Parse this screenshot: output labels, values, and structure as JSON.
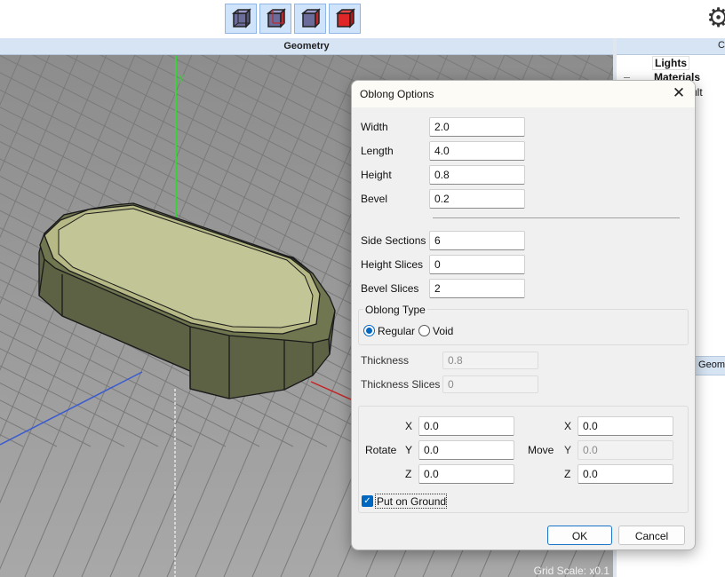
{
  "toolbar": {
    "buttons": [
      {
        "name": "wireframe-cube-icon"
      },
      {
        "name": "shaded-wire-cube-icon"
      },
      {
        "name": "shaded-cube-icon"
      },
      {
        "name": "solid-cube-icon"
      }
    ],
    "settings_icon": "gear-icon"
  },
  "viewport": {
    "title": "Geometry",
    "grid_scale": "Grid Scale: x0.1",
    "axis_label": "y"
  },
  "right_panel": {
    "header": "C",
    "items": [
      "Lights",
      "Materials",
      "ult"
    ],
    "lower_header": "Geom"
  },
  "dialog": {
    "title": "Oblong Options",
    "close_glyph": "✕",
    "fields": {
      "width": {
        "label": "Width",
        "value": "2.0"
      },
      "length": {
        "label": "Length",
        "value": "4.0"
      },
      "height": {
        "label": "Height",
        "value": "0.8"
      },
      "bevel": {
        "label": "Bevel",
        "value": "0.2"
      },
      "side_sections": {
        "label": "Side Sections",
        "value": "6"
      },
      "height_slices": {
        "label": "Height Slices",
        "value": "0"
      },
      "bevel_slices": {
        "label": "Bevel Slices",
        "value": "2"
      },
      "thickness": {
        "label": "Thickness",
        "value": "0.8"
      },
      "thickness_slices": {
        "label": "Thickness Slices",
        "value": "0"
      }
    },
    "oblong_type": {
      "label": "Oblong Type",
      "options": [
        "Regular",
        "Void"
      ],
      "selected": "Regular"
    },
    "rotate": {
      "label": "Rotate",
      "x": "0.0",
      "y": "0.0",
      "z": "0.0"
    },
    "move": {
      "label": "Move",
      "x": "0.0",
      "y": "0.0",
      "z": "0.0"
    },
    "axis": {
      "x": "X",
      "y": "Y",
      "z": "Z"
    },
    "put_on_ground": {
      "label": "Put on Ground",
      "checked": true
    },
    "ok_label": "OK",
    "cancel_label": "Cancel"
  }
}
